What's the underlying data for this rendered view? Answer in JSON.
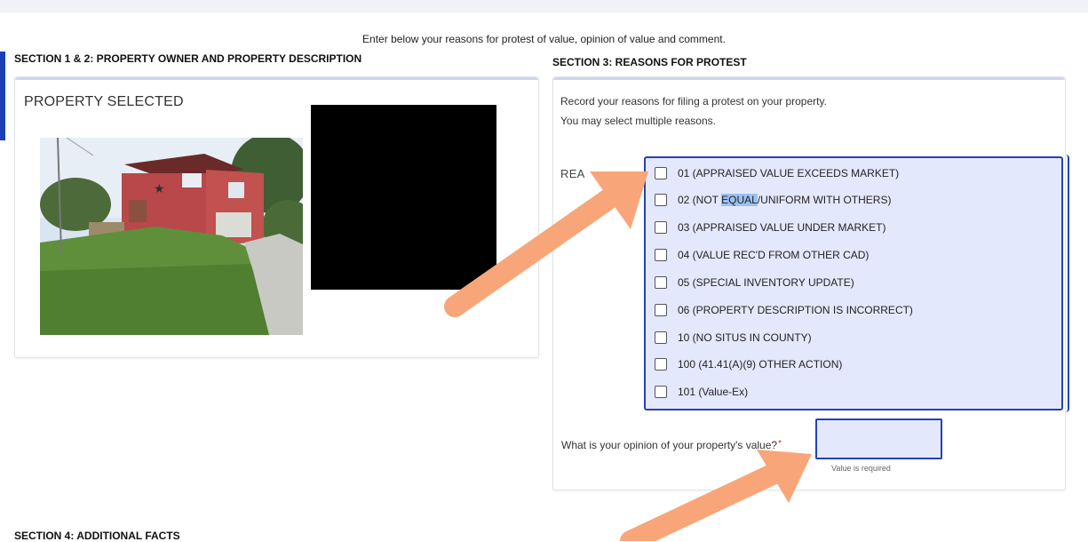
{
  "intro_text": "Enter below your reasons for protest of value, opinion of value and comment.",
  "section12": {
    "title": "SECTION 1 & 2: PROPERTY OWNER AND PROPERTY DESCRIPTION",
    "property_label": "PROPERTY SELECTED"
  },
  "section3": {
    "title": "SECTION 3: REASONS FOR PROTEST",
    "intro_line1": "Record your reasons for filing a protest on your property.",
    "intro_line2": "You may select multiple reasons.",
    "reasons_label": "REA",
    "reasons": [
      {
        "label": "01 (APPRAISED VALUE EXCEEDS MARKET)",
        "checked": false
      },
      {
        "label_before": "02 (NOT ",
        "label_hl": "EQUAL",
        "label_after": "/UNIFORM WITH OTHERS)",
        "checked": false
      },
      {
        "label": "03 (APPRAISED VALUE UNDER MARKET)",
        "checked": false
      },
      {
        "label": "04 (VALUE REC'D FROM OTHER CAD)",
        "checked": false
      },
      {
        "label": "05 (SPECIAL INVENTORY UPDATE)",
        "checked": false
      },
      {
        "label": "06 (PROPERTY DESCRIPTION IS INCORRECT)",
        "checked": false
      },
      {
        "label": "10 (NO SITUS IN COUNTY)",
        "checked": false
      },
      {
        "label": "100 (41.41(A)(9) OTHER ACTION)",
        "checked": false
      },
      {
        "label": "101 (Value-Ex)",
        "checked": false
      }
    ],
    "opinion_label": "What is your opinion of your property's value?",
    "opinion_required_mark": "*",
    "opinion_value": "",
    "validation_message": "Value is required"
  },
  "section4": {
    "title": "SECTION 4: ADDITIONAL FACTS"
  },
  "colors": {
    "accent": "#2443b7",
    "highlight_fill": "#e4e8fd",
    "arrow": "#f8a679"
  }
}
